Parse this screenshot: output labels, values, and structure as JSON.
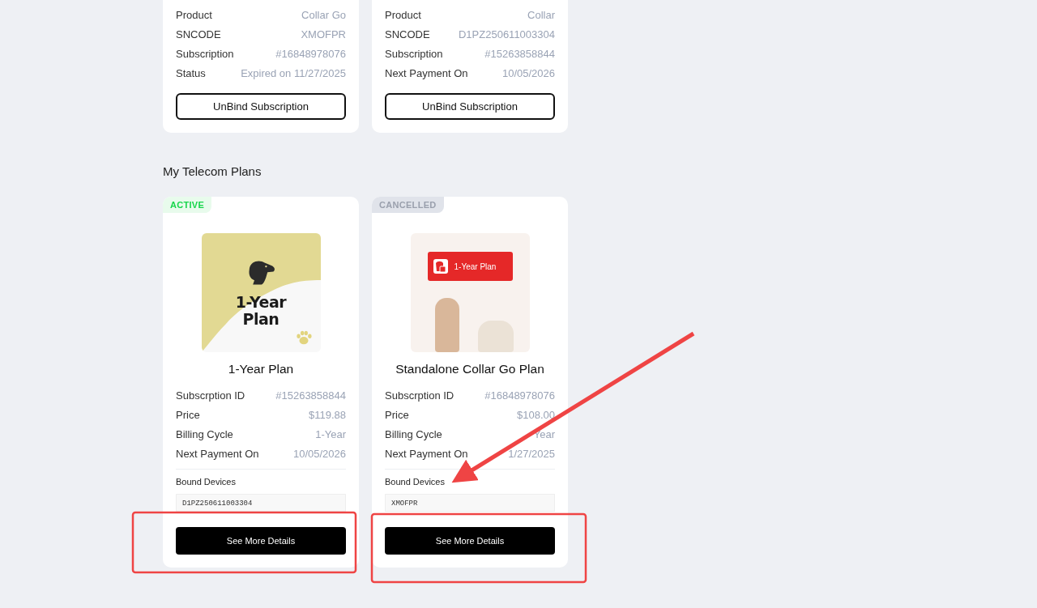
{
  "subscriptions": [
    {
      "rows": [
        {
          "label": "Product",
          "value": "Collar Go"
        },
        {
          "label": "SNCODE",
          "value": "XMOFPR"
        },
        {
          "label": "Subscription",
          "value": "#16848978076"
        },
        {
          "label": "Status",
          "value": "Expired on 11/27/2025"
        }
      ],
      "button": "UnBind Subscription"
    },
    {
      "rows": [
        {
          "label": "Product",
          "value": "Collar"
        },
        {
          "label": "SNCODE",
          "value": "D1PZ250611003304"
        },
        {
          "label": "Subscription",
          "value": "#15263858844"
        },
        {
          "label": "Next Payment On",
          "value": "10/05/2026"
        }
      ],
      "button": "UnBind Subscription"
    }
  ],
  "telecom_plans": {
    "title": "My Telecom Plans",
    "plans": [
      {
        "kind": "active",
        "status_label": "ACTIVE",
        "image": {
          "kind": "illustration",
          "text_lines": [
            "1-Year",
            "Plan"
          ]
        },
        "name": "1-Year Plan",
        "rows": [
          {
            "label": "Subscrption ID",
            "value": "#15263858844"
          },
          {
            "label": "Price",
            "value": "$119.88"
          },
          {
            "label": "Billing Cycle",
            "value": "1-Year"
          },
          {
            "label": "Next Payment On",
            "value": "10/05/2026"
          }
        ],
        "devices_label": "Bound Devices",
        "device": "D1PZ250611003304",
        "button": "See More Details"
      },
      {
        "kind": "cancelled",
        "status_label": "CANCELLED",
        "image": {
          "kind": "photo",
          "badge": "1-Year Plan"
        },
        "name": "Standalone Collar Go Plan",
        "rows": [
          {
            "label": "Subscrption ID",
            "value": "#16848978076"
          },
          {
            "label": "Price",
            "value": "$108.00"
          },
          {
            "label": "Billing Cycle",
            "value": "Year"
          },
          {
            "label": "Next Payment On",
            "value": "1/27/2025"
          }
        ],
        "devices_label": "Bound Devices",
        "device": "XMOFPR",
        "button": "See More Details"
      }
    ]
  }
}
